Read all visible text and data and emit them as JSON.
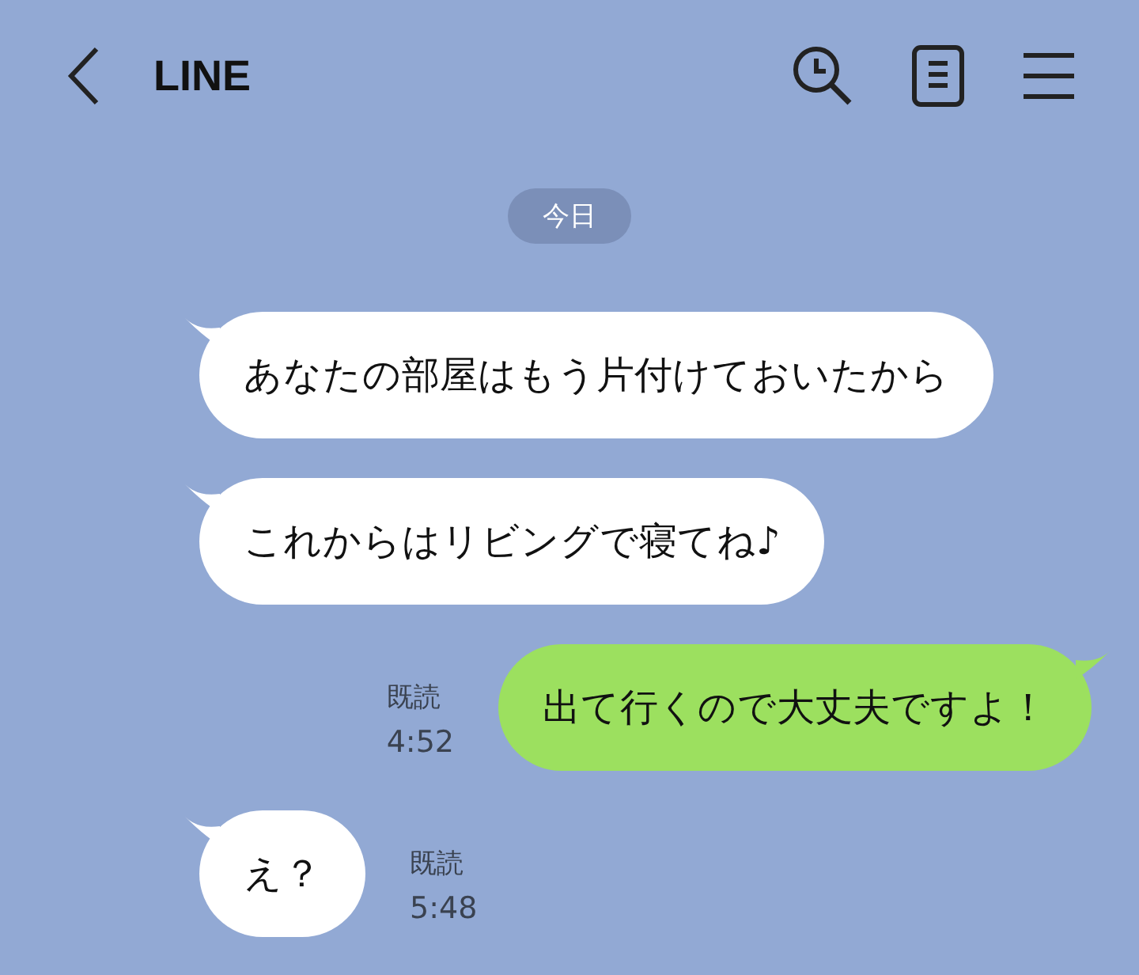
{
  "header": {
    "title": "LINE"
  },
  "date_chip": "今日",
  "messages": [
    {
      "kind": "received",
      "text": "あなたの部屋はもう片付けておいたから"
    },
    {
      "kind": "received",
      "text": "これからはリビングで寝てね♪"
    },
    {
      "kind": "sent",
      "text": "出て行くので大丈夫ですよ！",
      "read": "既読",
      "time": "4:52"
    },
    {
      "kind": "received",
      "text": "え？",
      "read": "既読",
      "time": "5:48"
    }
  ]
}
